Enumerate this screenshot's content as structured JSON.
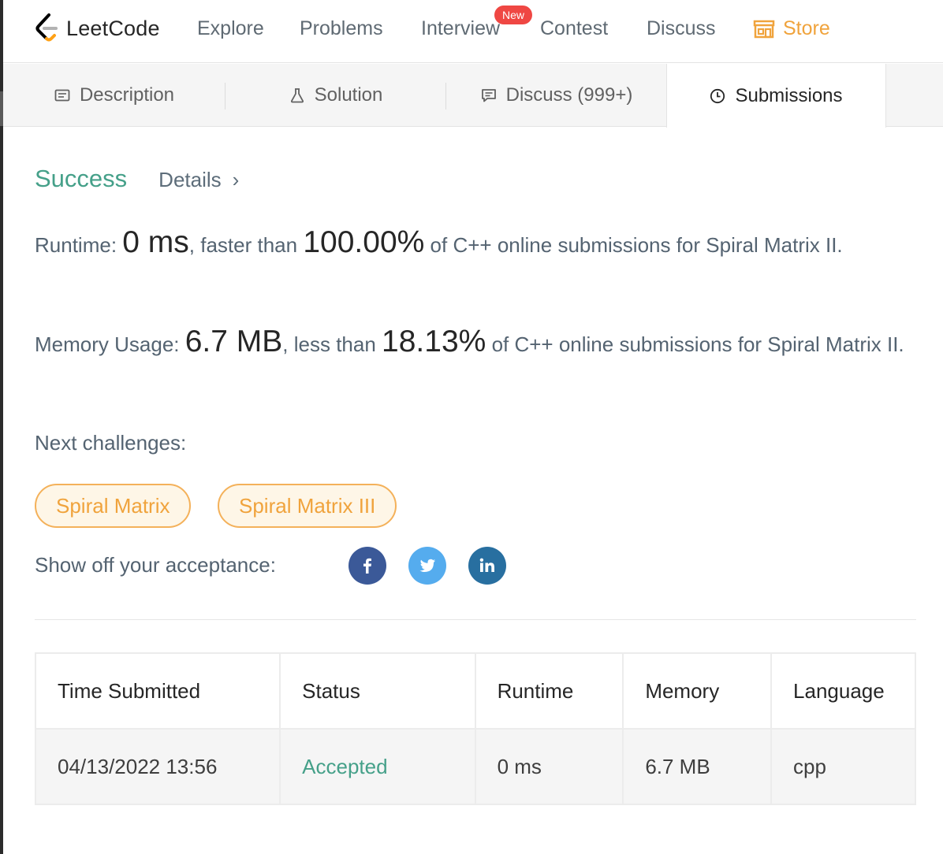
{
  "nav": {
    "logo_text": "LeetCode",
    "items": [
      "Explore",
      "Problems",
      "Interview",
      "Contest",
      "Discuss"
    ],
    "new_badge": "New",
    "store_label": "Store",
    "store_color": "#f0a33c"
  },
  "tabs": [
    {
      "label": "Description",
      "icon": "description-icon"
    },
    {
      "label": "Solution",
      "icon": "flask-icon"
    },
    {
      "label": "Discuss (999+)",
      "icon": "comment-icon"
    },
    {
      "label": "Submissions",
      "icon": "clock-icon",
      "active": true
    }
  ],
  "result": {
    "status": "Success",
    "status_color": "#45a089",
    "details_label": "Details",
    "runtime": {
      "label": "Runtime:",
      "value": "0 ms",
      "mid": ", faster than",
      "percent": "100.00%",
      "tail": "of C++ online submissions for Spiral Matrix II."
    },
    "memory": {
      "label": "Memory Usage:",
      "value": "6.7 MB",
      "mid": ", less than",
      "percent": "18.13%",
      "tail": "of C++ online submissions for Spiral Matrix II."
    },
    "next_label": "Next challenges:",
    "next_challenges": [
      "Spiral Matrix",
      "Spiral Matrix III"
    ],
    "share_label": "Show off your acceptance:",
    "share": [
      {
        "name": "facebook-icon",
        "color": "#3b5998"
      },
      {
        "name": "twitter-icon",
        "color": "#55acee"
      },
      {
        "name": "linkedin-icon",
        "color": "#286fa0"
      }
    ]
  },
  "submissions": {
    "headers": [
      "Time Submitted",
      "Status",
      "Runtime",
      "Memory",
      "Language"
    ],
    "rows": [
      [
        "04/13/2022 13:56",
        "Accepted",
        "0 ms",
        "6.7 MB",
        "cpp"
      ]
    ]
  }
}
